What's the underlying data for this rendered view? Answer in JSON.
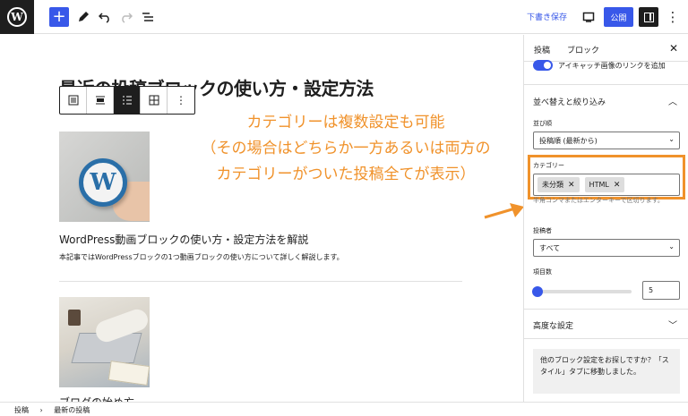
{
  "toolbar": {
    "logo_letter": "W",
    "draft_label": "下書き保存",
    "publish_label": "公開"
  },
  "canvas": {
    "post_title": "最近の投稿ブロックの使い方・設定方法",
    "posts": [
      {
        "title": "WordPress動画ブロックの使い方・設定方法を解説",
        "excerpt": "本記事ではWordPressブロックの1つ動画ブロックの使い方について詳しく解説します。"
      },
      {
        "title": "ブログの始め方"
      }
    ]
  },
  "annotation": {
    "lines": [
      "カテゴリーは複数設定も可能",
      "（その場合はどちらか一方あるいは両方の",
      "カテゴリーがついた投稿全てが表示）"
    ],
    "color": "#f0922b"
  },
  "sidebar": {
    "tabs": {
      "post": "投稿",
      "block": "ブロック"
    },
    "featured_link_label": "アイキャッチ画像のリンクを追加",
    "sort_panel": {
      "title": "並べ替えと絞り込み",
      "order_label": "並び順",
      "order_value": "投稿順 (最新から)",
      "category_label": "カテゴリー",
      "categories": [
        "未分類",
        "HTML"
      ],
      "category_help": "半角コンマまたはエンターキーで区切ります。",
      "author_label": "投稿者",
      "author_value": "すべて",
      "count_label": "項目数",
      "count_value": "5"
    },
    "advanced_label": "高度な設定",
    "tip_text": "他のブロック設定をお探しですか？「スタイル」タブに移動しました。"
  },
  "footer": {
    "breadcrumb": [
      "投稿",
      "最新の投稿"
    ]
  },
  "colors": {
    "accent": "#3858e9",
    "annotation": "#f0922b"
  }
}
